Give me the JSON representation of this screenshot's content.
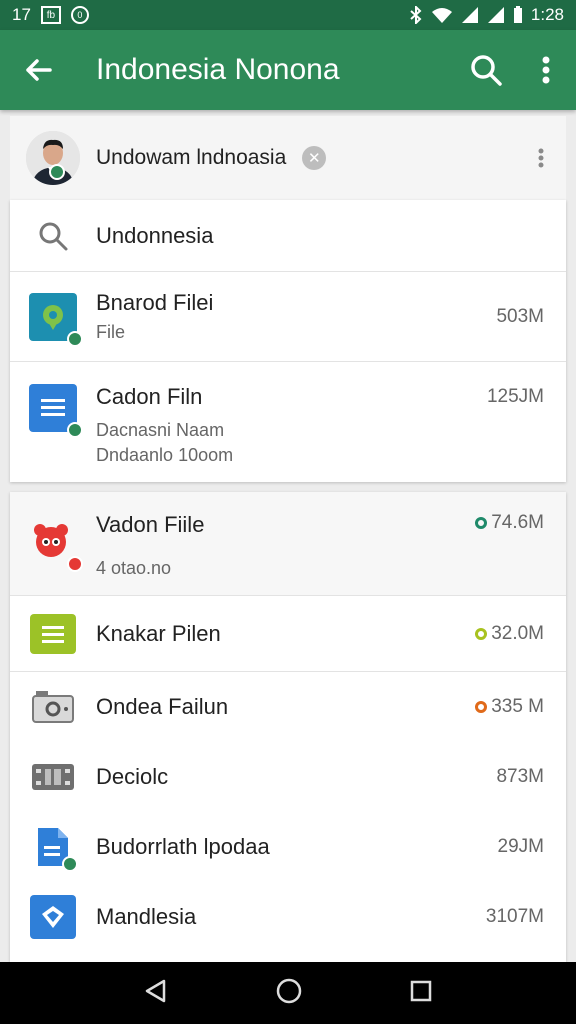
{
  "status": {
    "left_number": "17",
    "box_label": "fb",
    "circle_label": "0",
    "time": "1:28"
  },
  "app_bar": {
    "title": "Indonesia Nonona"
  },
  "account": {
    "name": "Undowam lndnoasia"
  },
  "search": {
    "query": "Undonnesia"
  },
  "card1_rows": [
    {
      "title": "Bnarod Filei",
      "sub": "File",
      "size": "503M",
      "icon": "map-pin-icon",
      "icon_color": "#1d8fb0"
    },
    {
      "title": "Cadon Filn",
      "sub": "Dacnasni Naam",
      "sub2": "Dndaanlo 10oom",
      "size": "125JM",
      "icon": "doc-lines-icon",
      "icon_color": "#2f7fd8"
    }
  ],
  "card2_rows": [
    {
      "title": "Vadon Fiile",
      "sub": "4 otao.no",
      "size": "74.6M",
      "dot_color": "#1f8a6a",
      "icon": "red-creature-icon",
      "icon_color": "#e53935"
    },
    {
      "title": "Knakar Pilen",
      "size": "32.0M",
      "dot_color": "#a8c21f",
      "icon": "green-list-icon",
      "icon_color": "#9cc227"
    },
    {
      "title": "Ondea Failun",
      "size": "335 M",
      "dot_color": "#e06a1a",
      "icon": "drive-icon",
      "icon_color": "#8a8a8a"
    },
    {
      "title": "Deciolc",
      "size": "873M",
      "icon": "film-icon",
      "icon_color": "#6f6f6f"
    },
    {
      "title": "Budorrlath lpodaa",
      "size": "29JM",
      "icon": "blue-doc-icon",
      "icon_color": "#2f7fd8"
    },
    {
      "title": "Mandlesia",
      "size": "3107M",
      "icon": "blue-shield-icon",
      "icon_color": "#2f7fd8"
    }
  ],
  "colors": {
    "primary": "#2e8a58",
    "status_bar": "#1f6b45",
    "badge_green": "#2e8a58"
  }
}
